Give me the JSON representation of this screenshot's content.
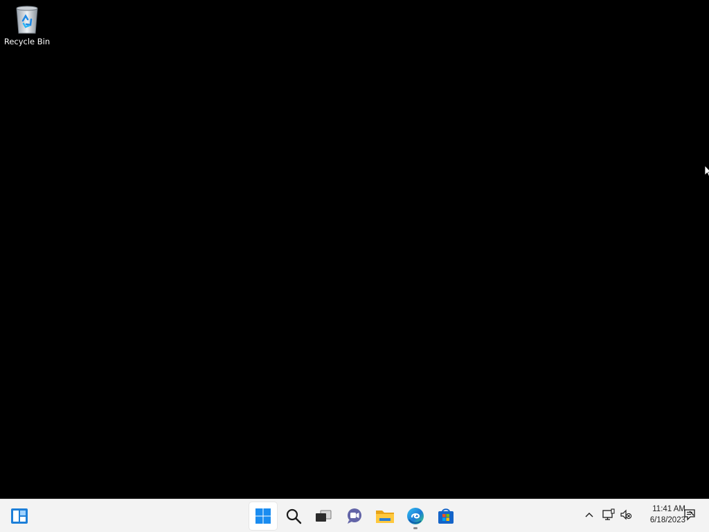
{
  "desktop": {
    "icons": [
      {
        "label": "Recycle Bin",
        "icon": "recycle-bin-icon"
      }
    ]
  },
  "taskbar": {
    "widgets": {
      "icon": "widgets-icon"
    },
    "apps": [
      {
        "name": "Start",
        "icon": "windows-start-icon",
        "active": true
      },
      {
        "name": "Search",
        "icon": "search-icon"
      },
      {
        "name": "Task View",
        "icon": "task-view-icon"
      },
      {
        "name": "Chat",
        "icon": "teams-chat-icon"
      },
      {
        "name": "File Explorer",
        "icon": "file-explorer-icon"
      },
      {
        "name": "Microsoft Edge",
        "icon": "edge-icon",
        "running": true
      },
      {
        "name": "Microsoft Store",
        "icon": "store-icon"
      }
    ],
    "tray": {
      "overflow": "chevron-up-icon",
      "network": "network-icon",
      "volume": "volume-muted-icon",
      "notifications": "notification-icon"
    },
    "clock": {
      "time": "11:41 AM",
      "date": "6/18/2023"
    }
  },
  "colors": {
    "desktop_background": "#000000",
    "taskbar_background": "#f3f3f3",
    "accent": "#0078d4"
  }
}
